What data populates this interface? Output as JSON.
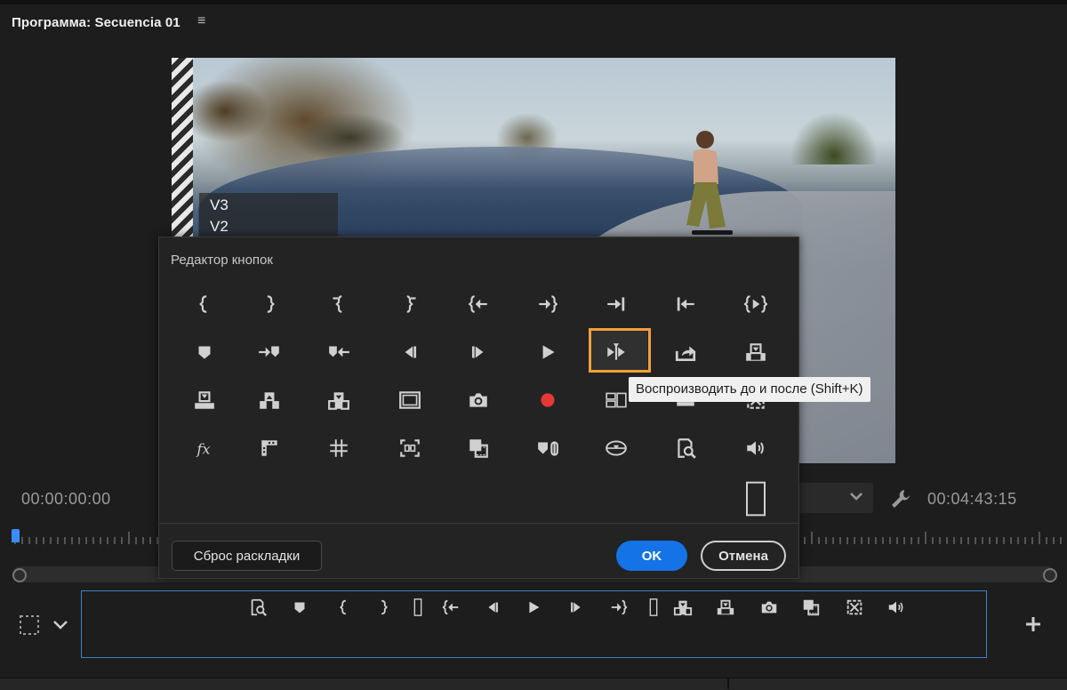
{
  "panel": {
    "title": "Программа: Secuencia 01",
    "menu_icon": "hamburger-menu-icon"
  },
  "video": {
    "tracks": [
      "V3",
      "V2"
    ]
  },
  "transport": {
    "timecode_current": "00:00:00:00",
    "timecode_duration": "00:04:43:15",
    "settings_icon": "wrench-icon"
  },
  "dialog": {
    "title": "Редактор кнопок",
    "tooltip": "Воспроизводить до и после (Shift+K)",
    "buttons": {
      "reset": "Сброс раскладки",
      "ok": "OK",
      "cancel": "Отмена"
    },
    "icons": [
      [
        "mark-in-icon",
        "mark-out-icon",
        "clear-in-icon",
        "clear-out-icon",
        "go-to-in-icon",
        "go-to-out-icon",
        "go-to-next-edit-icon",
        "go-to-previous-edit-icon",
        "play-in-to-out-icon"
      ],
      [
        "add-marker-icon",
        "go-to-next-marker-icon",
        "go-to-previous-marker-icon",
        "step-back-icon",
        "step-forward-icon",
        "play-icon",
        "play-around-icon",
        "export-frame-icon",
        "overwrite-icon"
      ],
      [
        "lift-icon",
        "extract-icon",
        "insert-icon",
        "safe-margins-icon",
        "camera-icon",
        "record-icon",
        "multi-camera-icon",
        "trim-icon",
        "proxy-icon"
      ],
      [
        "fx-icon",
        "comparison-view-icon",
        "grid-icon",
        "fit-icon",
        "frame-icon",
        "marker-link-icon",
        "vr-video-icon",
        "loop-icon",
        "volume-icon"
      ]
    ],
    "selected_icon": "play-around-icon",
    "spacer_icon": "spacer-icon"
  },
  "button_bar": {
    "icons": [
      "loop-icon",
      "add-marker-icon",
      "mark-in-icon",
      "mark-out-icon",
      "spacer-icon",
      "go-to-in-icon",
      "step-back-icon",
      "play-icon",
      "step-forward-icon",
      "go-to-out-icon",
      "spacer-icon",
      "insert-icon",
      "overwrite-icon",
      "camera-icon",
      "frame-icon",
      "proxy-icon",
      "volume-icon"
    ]
  },
  "colors": {
    "accent_blue": "#1473e6",
    "selection_orange": "#f0a03a",
    "record_red": "#e53935"
  }
}
